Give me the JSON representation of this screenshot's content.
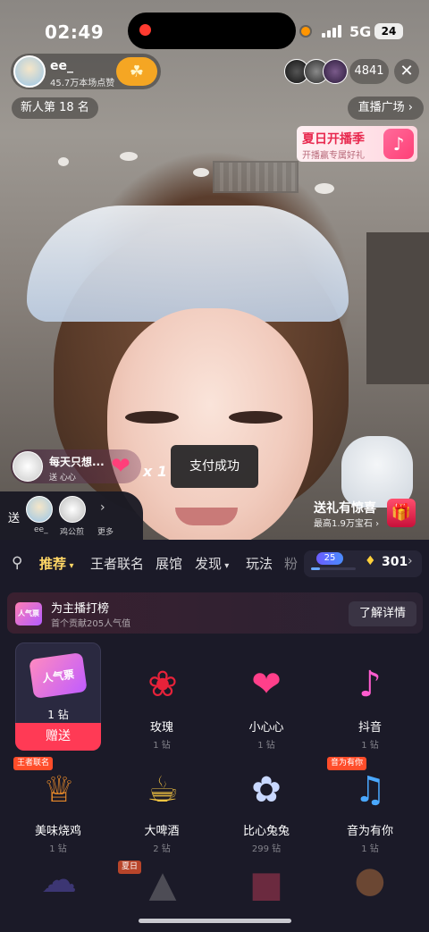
{
  "status_bar": {
    "time": "02:49",
    "network": "5G",
    "battery": "24"
  },
  "host": {
    "name": "ee_",
    "likes": "45.7万本场点赞"
  },
  "viewers": {
    "count": "4841"
  },
  "rank_chip": "新人第 18 名",
  "plaza_chip": "直播广场",
  "promo": {
    "title": "夏日开播季",
    "subtitle": "开播赢专属好礼"
  },
  "gift_toast": {
    "text": "每天只想...",
    "sub": "送 心心",
    "multiplier": "x 1"
  },
  "payment_toast": "支付成功",
  "send_gift_banner": {
    "title": "送礼有惊喜",
    "subtitle": "最高1.9万宝石"
  },
  "send_to": {
    "label": "送",
    "receivers": [
      {
        "name": "ee_"
      },
      {
        "name": "鸡公煎"
      }
    ],
    "more_label": "更多"
  },
  "tabs": {
    "items": [
      "推荐",
      "王者联名",
      "展馆",
      "发现",
      "玩法",
      "粉"
    ],
    "active": "推荐"
  },
  "wallet": {
    "fan_level": "25",
    "fan_progress": 0.2,
    "coins": "301"
  },
  "rank_banner": {
    "icon_text": "人气票",
    "title": "为主播打榜",
    "subtitle": "首个贡献205人气值",
    "button": "了解详情"
  },
  "selected_gift": {
    "image_text": "人气票",
    "price": "1 钻",
    "action": "赠送"
  },
  "gifts": [
    {
      "name": "玫瑰",
      "price": "1 钻",
      "icon": "rose"
    },
    {
      "name": "小心心",
      "price": "1 钻",
      "icon": "heart"
    },
    {
      "name": "抖音",
      "price": "1 钻",
      "icon": "douyin"
    },
    {
      "name": "美味烧鸡",
      "price": "1 钻",
      "icon": "chicken",
      "tag": "王者联名"
    },
    {
      "name": "大啤酒",
      "price": "2 钻",
      "icon": "beer"
    },
    {
      "name": "比心兔兔",
      "price": "299 钻",
      "icon": "rabbit"
    },
    {
      "name": "音为有你",
      "price": "1 钻",
      "icon": "music-note",
      "tag": "音为有你"
    }
  ],
  "row3_tag": "夏日"
}
